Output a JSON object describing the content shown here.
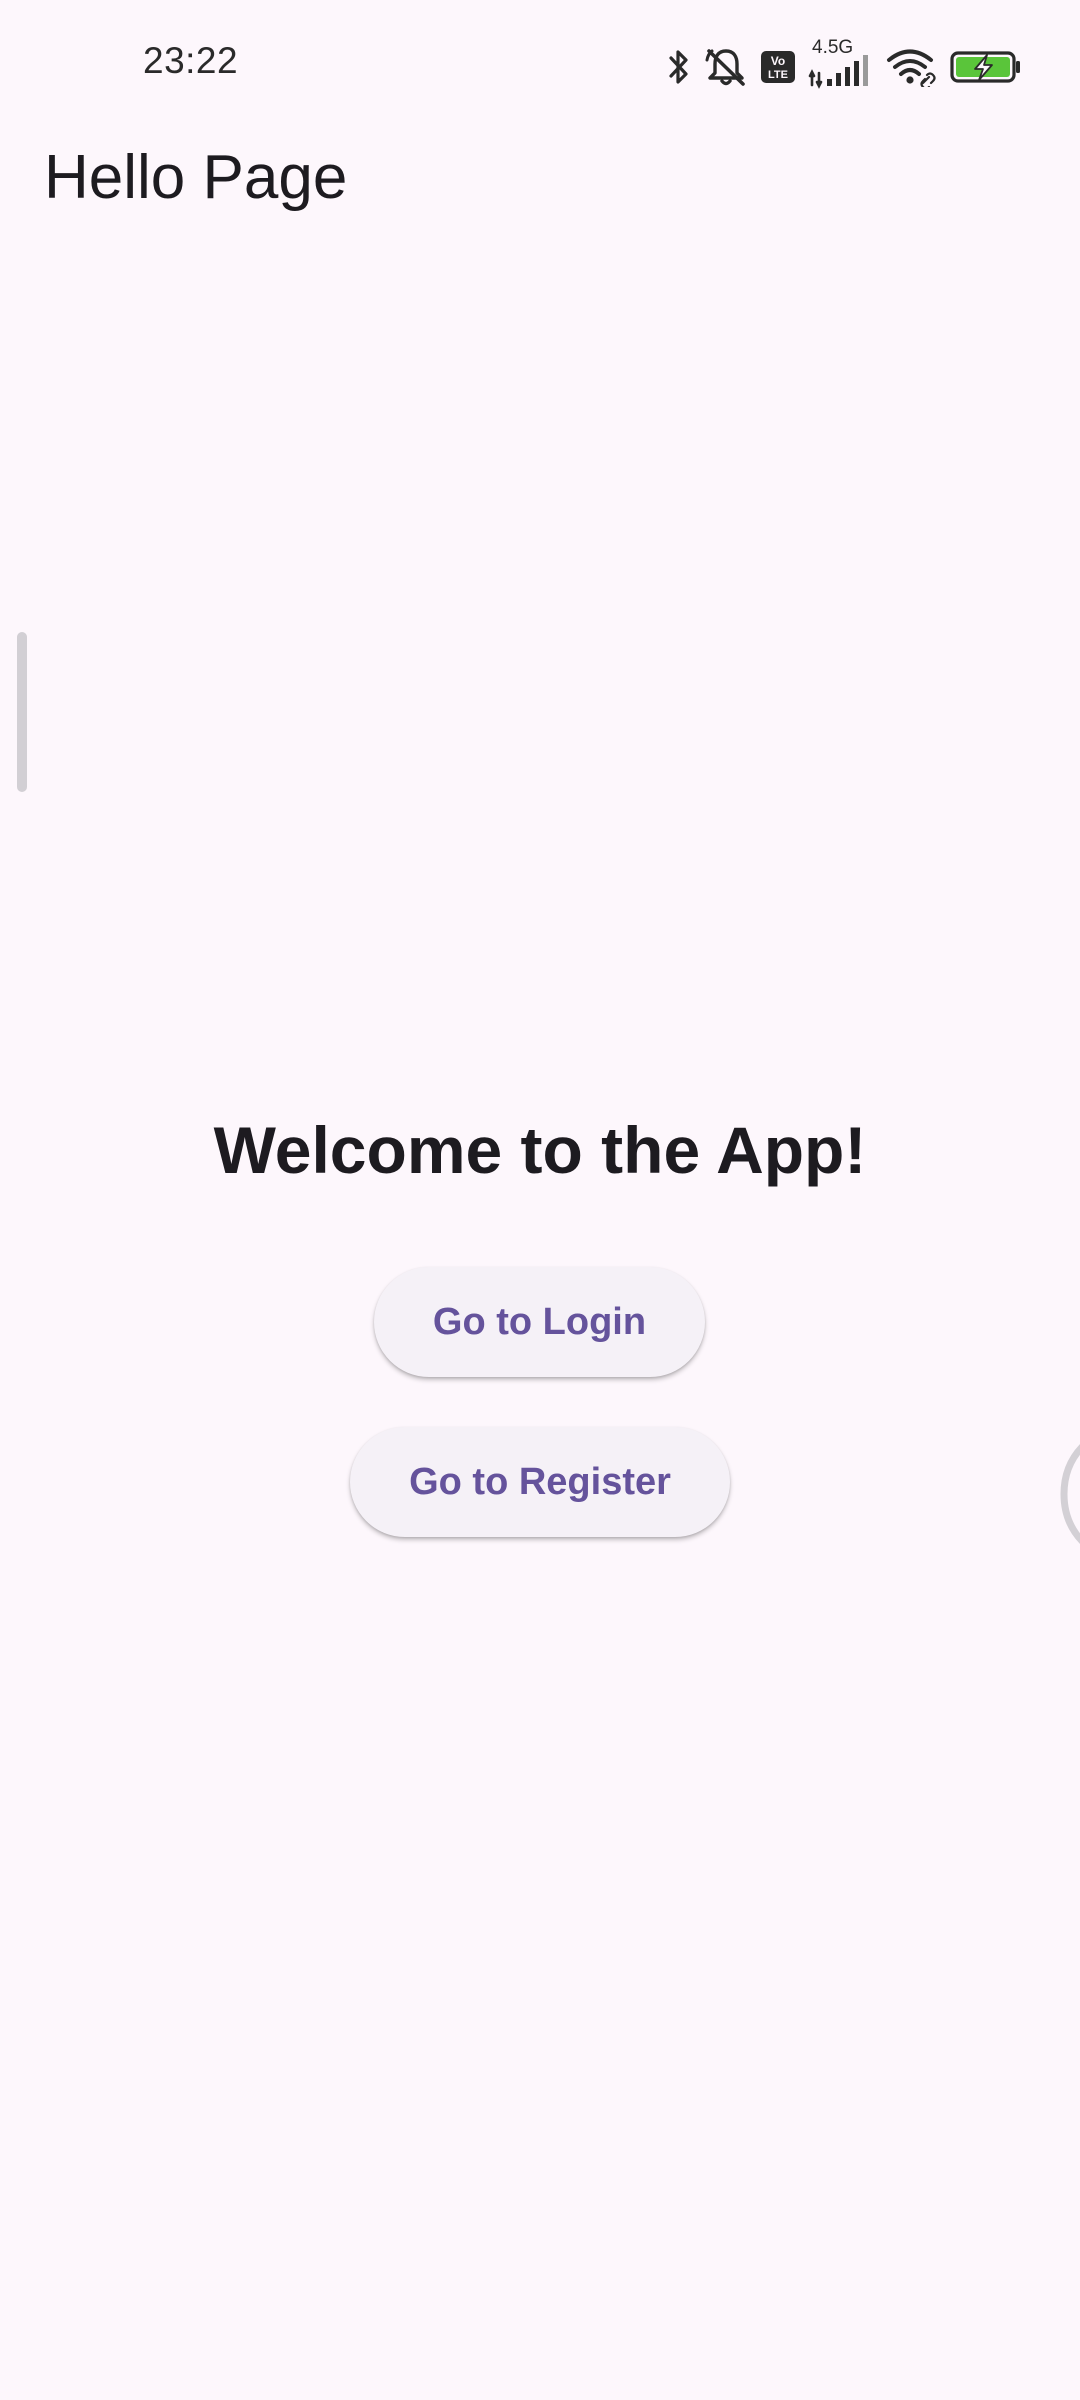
{
  "status_bar": {
    "time": "23:22",
    "network_label": "4.5G",
    "volte_label": "Vo LTE",
    "icons": [
      "bluetooth-icon",
      "bell-off-icon",
      "volte-icon",
      "cellular-signal-icon",
      "wifi-icon",
      "battery-charging-icon"
    ],
    "battery_color": "#5ac53a"
  },
  "app_bar": {
    "title": "Hello Page"
  },
  "main": {
    "heading": "Welcome to the App!",
    "login_button_label": "Go to Login",
    "register_button_label": "Go to Register"
  },
  "theme": {
    "background": "#fdf7fc",
    "button_background": "#f5f1f7",
    "button_text": "#65539c",
    "text_primary": "#1d1b20"
  }
}
